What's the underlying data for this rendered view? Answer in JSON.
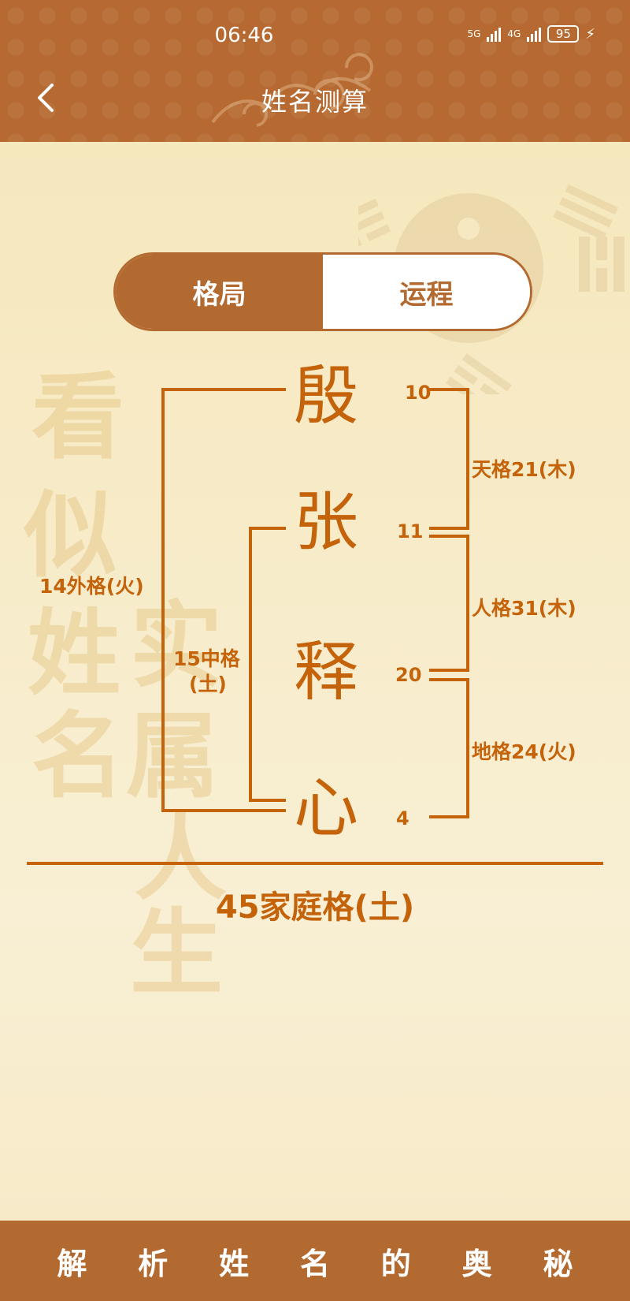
{
  "status_bar": {
    "time": "06:46",
    "network_1": "5G",
    "network_2": "4G",
    "battery": "95"
  },
  "header": {
    "title": "姓名测算",
    "back_icon": "chevron-left-icon"
  },
  "tabs": [
    {
      "label": "格局",
      "active": true
    },
    {
      "label": "运程",
      "active": false
    }
  ],
  "watermark": {
    "left_column": [
      "看",
      "似",
      "姓",
      "名"
    ],
    "right_column": [
      "实",
      "属",
      "人",
      "生"
    ]
  },
  "name_chars": [
    "殷",
    "张",
    "释",
    "心"
  ],
  "strokes": [
    "10",
    "11",
    "20",
    "4"
  ],
  "grids": {
    "outer": "14外格(火)",
    "middle_line1": "15中格",
    "middle_line2": "(土)",
    "heaven": "天格21(木)",
    "person": "人格31(木)",
    "earth": "地格24(火)",
    "family": "45家庭格(土)"
  },
  "footer": {
    "chars": [
      "解",
      "析",
      "姓",
      "名",
      "的",
      "奥",
      "秘"
    ]
  },
  "colors": {
    "brand": "#b36a30",
    "accent": "#c4630a",
    "background": "#f7ebc8"
  }
}
